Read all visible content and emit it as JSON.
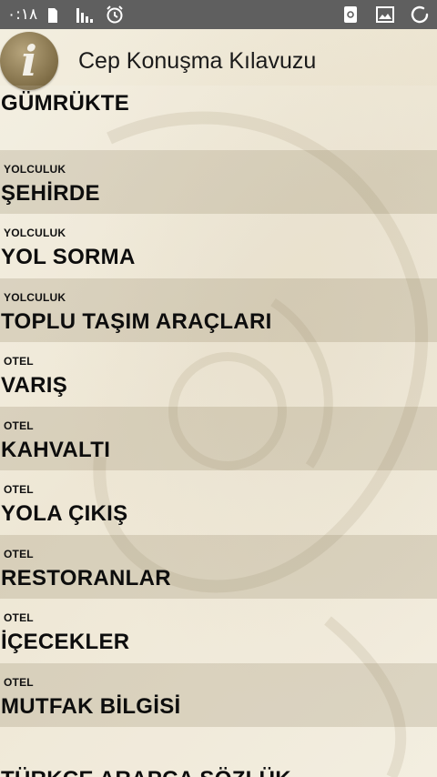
{
  "status_bar": {
    "time": "۰:۱۸",
    "icons": [
      "sim-icon",
      "battery-icon",
      "signal-icon",
      "alarm-icon",
      "sync-icon",
      "image-icon",
      "loading-icon"
    ]
  },
  "header": {
    "app_title": "Cep Konuşma Kılavuzu",
    "icon": "info-icon",
    "icon_glyph": "i"
  },
  "list": {
    "items": [
      {
        "category": "",
        "title": "GÜMRÜKTE"
      },
      {
        "category": "YOLCULUK",
        "title": "ŞEHİRDE"
      },
      {
        "category": "YOLCULUK",
        "title": "YOL SORMA"
      },
      {
        "category": "YOLCULUK",
        "title": "TOPLU TAŞIM ARAÇLARI"
      },
      {
        "category": "OTEL",
        "title": "VARIŞ"
      },
      {
        "category": "OTEL",
        "title": "KAHVALTI"
      },
      {
        "category": "OTEL",
        "title": "YOLA ÇIKIŞ"
      },
      {
        "category": "OTEL",
        "title": "RESTORANLAR"
      },
      {
        "category": "OTEL",
        "title": "İÇECEKLER"
      },
      {
        "category": "OTEL",
        "title": "MUTFAK BİLGİSİ"
      },
      {
        "category": "",
        "title": "TÜRKÇE ARAPÇA SÖZLÜK"
      }
    ]
  },
  "colors": {
    "status_bar": "#5f5f5f",
    "background": "#efe8d6",
    "badge": "#7f6d46"
  }
}
